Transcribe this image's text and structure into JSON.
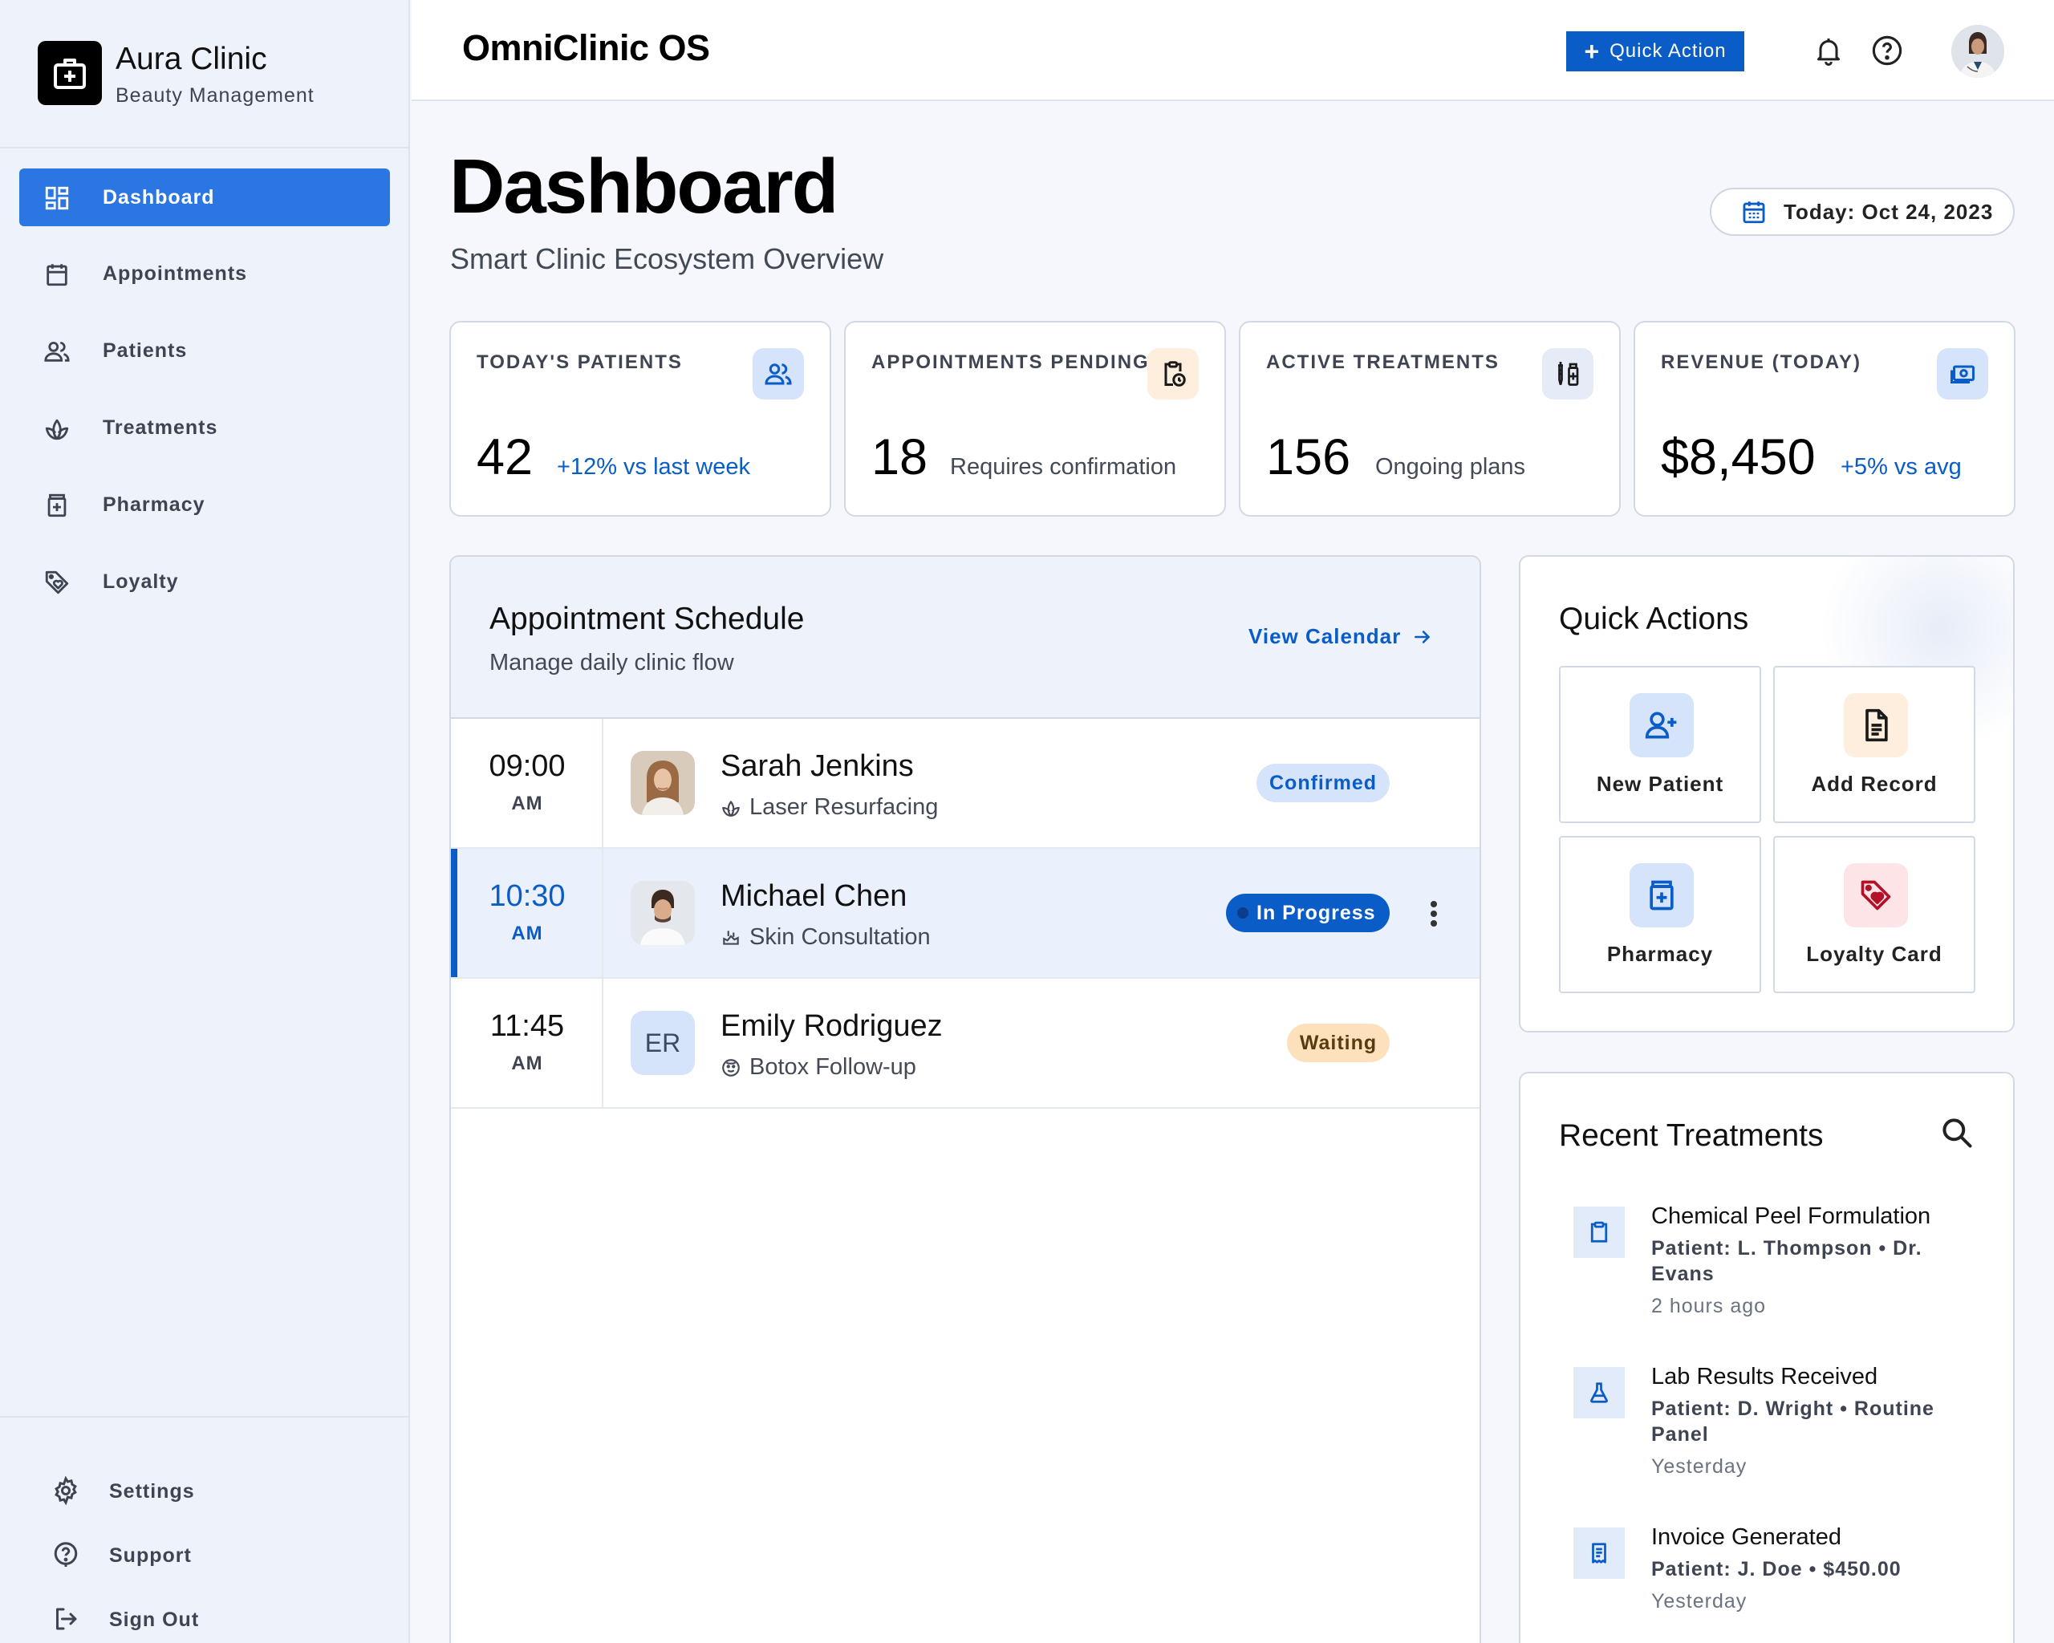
{
  "brand": {
    "name": "Aura Clinic",
    "subtitle": "Beauty Management",
    "logo_icon": "medical-bag-icon"
  },
  "sidebar": {
    "items": [
      {
        "label": "Dashboard",
        "icon": "dashboard-icon",
        "active": true
      },
      {
        "label": "Appointments",
        "icon": "calendar-icon"
      },
      {
        "label": "Patients",
        "icon": "patients-icon"
      },
      {
        "label": "Treatments",
        "icon": "lotus-icon"
      },
      {
        "label": "Pharmacy",
        "icon": "medicine-icon"
      },
      {
        "label": "Loyalty",
        "icon": "tag-heart-icon"
      }
    ],
    "footer": [
      {
        "label": "Settings",
        "icon": "gear-icon"
      },
      {
        "label": "Support",
        "icon": "help-icon"
      },
      {
        "label": "Sign Out",
        "icon": "logout-icon"
      }
    ]
  },
  "topbar": {
    "app_title": "OmniClinic OS",
    "quick_action_label": "Quick Action",
    "icons": [
      "bell-icon",
      "help-icon",
      "user-avatar"
    ]
  },
  "header": {
    "title": "Dashboard",
    "subtitle": "Smart Clinic Ecosystem Overview",
    "date_label": "Today: Oct 24, 2023"
  },
  "stats": [
    {
      "label": "TODAY'S PATIENTS",
      "value": "42",
      "note": "+12% vs last week",
      "icon": "patients-icon"
    },
    {
      "label": "APPOINTMENTS PENDING",
      "value": "18",
      "note": "Requires confirmation",
      "icon": "clipboard-clock-icon"
    },
    {
      "label": "ACTIVE TREATMENTS",
      "value": "156",
      "note": "Ongoing plans",
      "icon": "syringe-icon"
    },
    {
      "label": "REVENUE (TODAY)",
      "value": "$8,450",
      "note": "+5% vs avg",
      "icon": "payments-icon"
    }
  ],
  "schedule": {
    "title": "Appointment Schedule",
    "subtitle": "Manage daily clinic flow",
    "view_calendar": "View Calendar",
    "appointments": [
      {
        "time": "09:00",
        "ampm": "AM",
        "name": "Sarah Jenkins",
        "treatment": "Laser Resurfacing",
        "status": "Confirmed"
      },
      {
        "time": "10:30",
        "ampm": "AM",
        "name": "Michael Chen",
        "treatment": "Skin Consultation",
        "status": "In Progress"
      },
      {
        "time": "11:45",
        "ampm": "AM",
        "name": "Emily Rodriguez",
        "initials": "ER",
        "treatment": "Botox Follow-up",
        "status": "Waiting"
      }
    ]
  },
  "quick_actions": {
    "title": "Quick Actions",
    "items": [
      {
        "label": "New Patient",
        "icon": "person-add-icon"
      },
      {
        "label": "Add Record",
        "icon": "document-icon"
      },
      {
        "label": "Pharmacy",
        "icon": "medicine-icon"
      },
      {
        "label": "Loyalty Card",
        "icon": "tag-heart-icon"
      }
    ]
  },
  "recent": {
    "title": "Recent Treatments",
    "items": [
      {
        "name": "Chemical Peel Formulation",
        "detail": "Patient: L. Thompson • Dr. Evans",
        "time": "2 hours ago",
        "icon": "clipboard-icon"
      },
      {
        "name": "Lab Results Received",
        "detail": "Patient: D. Wright • Routine Panel",
        "time": "Yesterday",
        "icon": "flask-icon"
      },
      {
        "name": "Invoice Generated",
        "detail": "Patient: J. Doe • $450.00",
        "time": "Yesterday",
        "icon": "receipt-icon"
      }
    ]
  },
  "colors": {
    "primary": "#0a5cc7",
    "nav_active": "#2b76e2",
    "confirmed_bg": "#d5e4fb",
    "waiting_bg": "#fde1bd",
    "loyalty_red": "#b3102a"
  }
}
